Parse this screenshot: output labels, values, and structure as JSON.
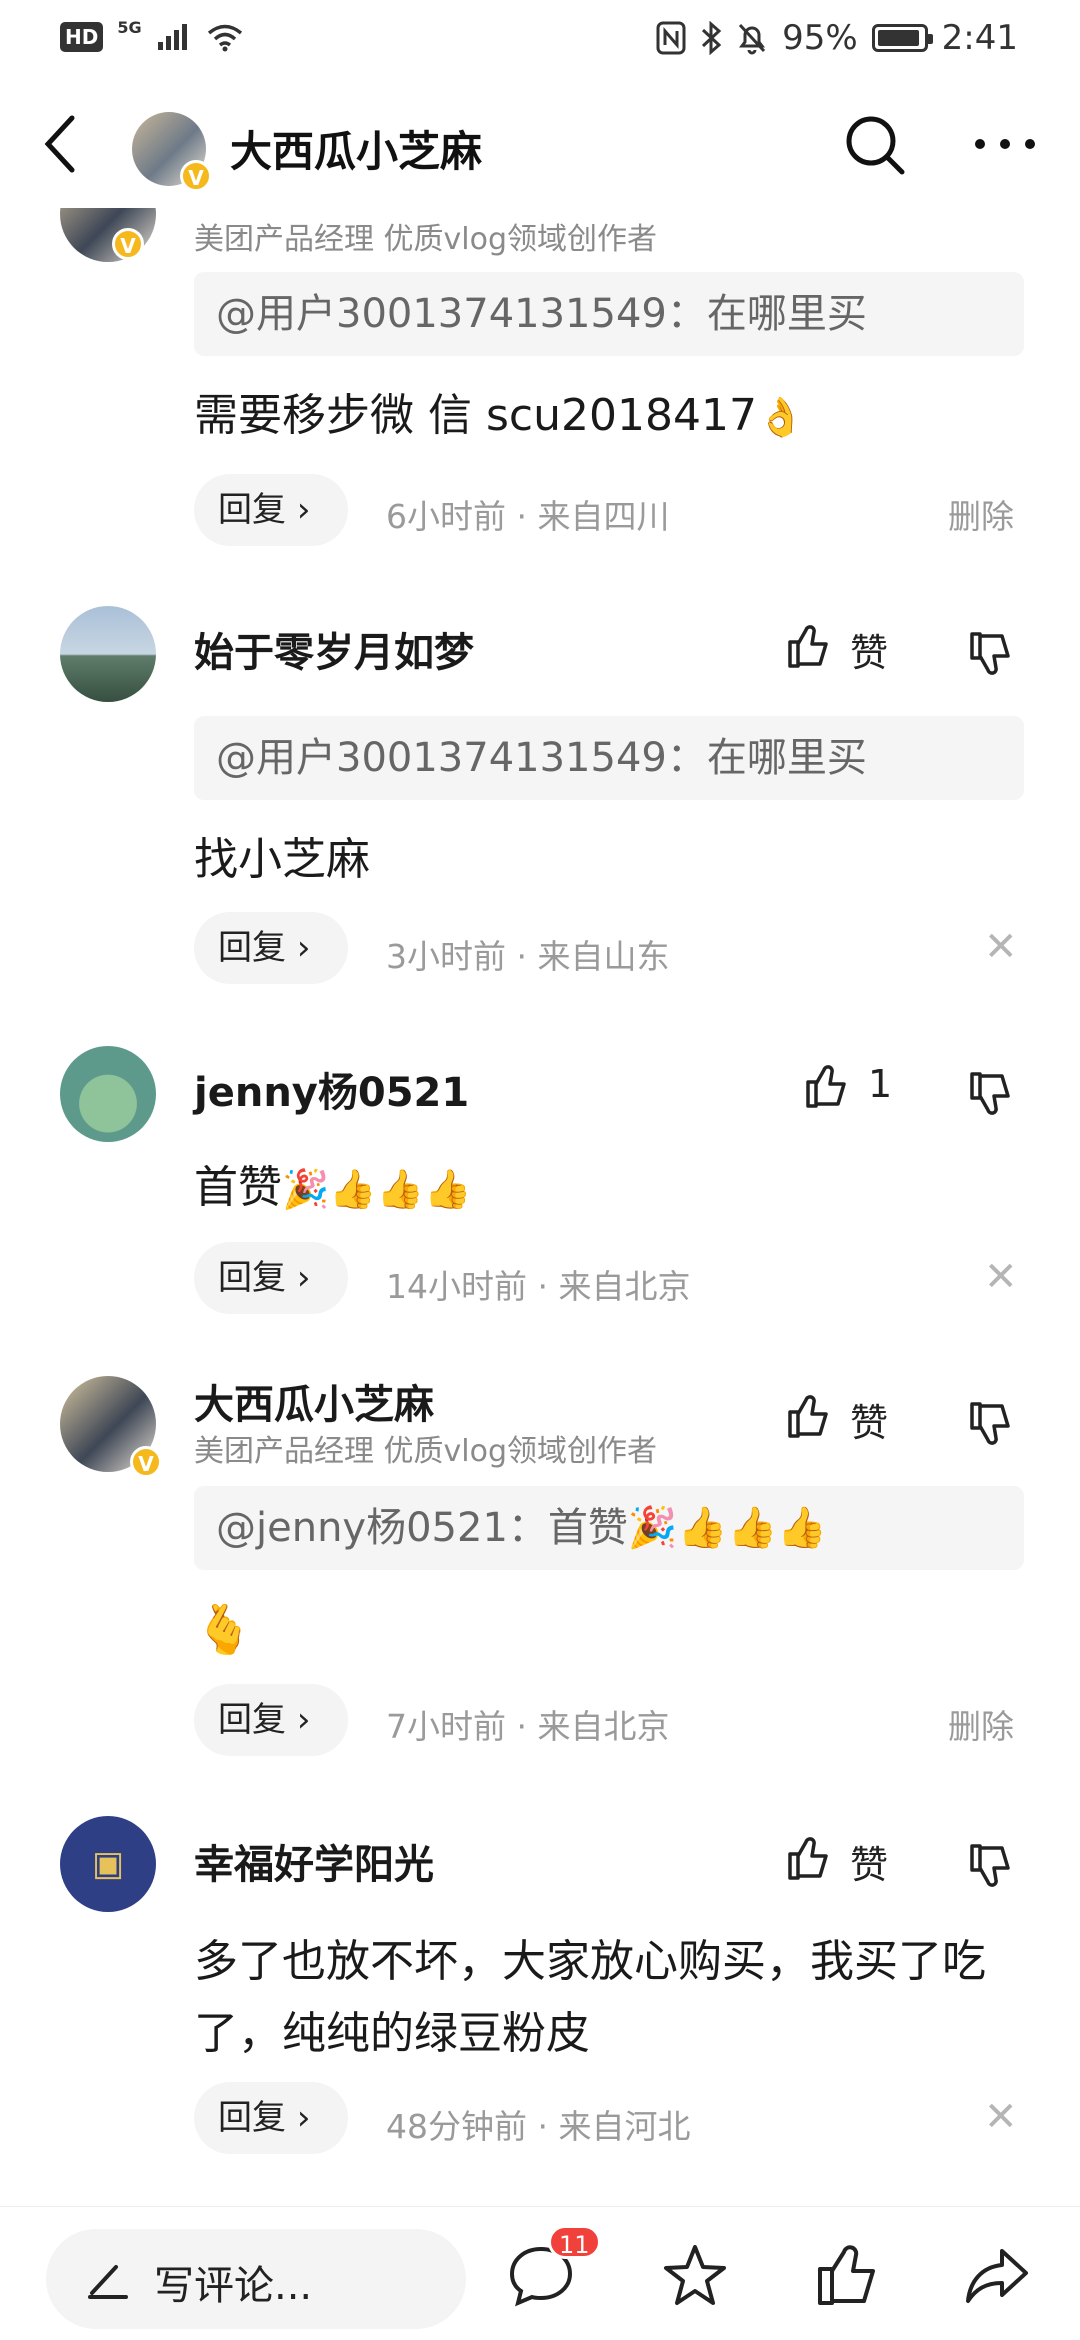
{
  "status_bar": {
    "hd": "HD",
    "network": "5G",
    "battery": "95%",
    "battery_level": 0.95,
    "time": "2:41"
  },
  "header": {
    "title": "大西瓜小芝麻",
    "verified_badge": "V"
  },
  "comments": [
    {
      "subtitle": "美团产品经理 优质vlog领域创作者",
      "quote": "@用户3001374131549：在哪里买",
      "body": "需要移步微 信 scu2018417",
      "body_emoji": "👌",
      "reply": "回复",
      "meta": "6小时前 · 来自四川",
      "action": "删除"
    },
    {
      "name": "始于零岁月如梦",
      "like_label": "赞",
      "quote": "@用户3001374131549：在哪里买",
      "body": "找小芝麻",
      "reply": "回复",
      "meta": "3小时前 · 来自山东"
    },
    {
      "name": "jenny杨0521",
      "like_label": "1",
      "body": "首赞",
      "body_emoji": "🎉👍👍👍",
      "reply": "回复",
      "meta": "14小时前 · 来自北京"
    },
    {
      "name": "大西瓜小芝麻",
      "subtitle": "美团产品经理 优质vlog领域创作者",
      "like_label": "赞",
      "quote": "@jenny杨0521：首赞",
      "quote_emoji": "🎉👍👍👍",
      "body_emoji": "🫰",
      "reply": "回复",
      "meta": "7小时前 · 来自北京",
      "action": "删除"
    },
    {
      "name": "幸福好学阳光",
      "like_label": "赞",
      "body": "多了也放不坏，大家放心购买，我买了吃了，纯纯的绿豆粉皮",
      "reply": "回复",
      "meta": "48分钟前 · 来自河北"
    }
  ],
  "bottom_bar": {
    "write_placeholder": "写评论...",
    "comment_count": "11"
  }
}
